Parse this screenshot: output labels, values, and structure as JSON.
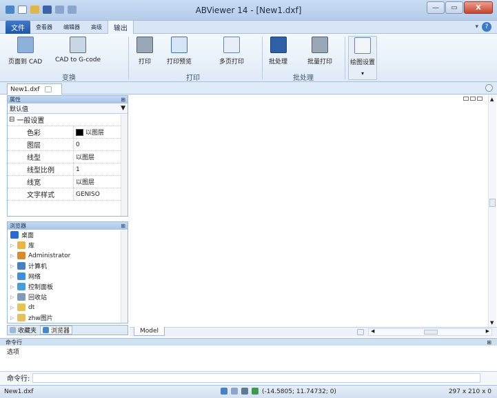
{
  "window": {
    "title": "ABViewer 14 - [New1.dxf]",
    "min": "—",
    "max": "▭",
    "close": "X"
  },
  "ribbon_tabs": [
    "文件",
    "查看器",
    "编辑器",
    "高级",
    "输出"
  ],
  "ribbon_right": {
    "style": "▾",
    "help": "?"
  },
  "ribbon": {
    "buttons": [
      {
        "label": "页面到 CAD",
        "icon": "page-to-cad-icon"
      },
      {
        "label": "CAD to G-code",
        "icon": "gcode-icon"
      },
      {
        "label": "打印",
        "icon": "printer-icon"
      },
      {
        "label": "打印预览",
        "icon": "print-preview-icon"
      },
      {
        "label": "多页打印",
        "icon": "multipage-print-icon"
      },
      {
        "label": "批处理",
        "icon": "batch-icon"
      },
      {
        "label": "批量打印",
        "icon": "batch-print-icon"
      },
      {
        "label": "绘图设置",
        "icon": "plot-settings-icon"
      }
    ],
    "groups": [
      "变换",
      "打印",
      "批处理"
    ],
    "dropdown_arrow": "▾"
  },
  "doc_tab": {
    "label": "New1.dxf"
  },
  "properties": {
    "title": "属性",
    "pin": "⊞",
    "selector": "默认值",
    "section": "一般设置",
    "section_expander": "⊟",
    "rows": [
      {
        "key": "色彩",
        "value": "以图层",
        "swatch": "#000000"
      },
      {
        "key": "图层",
        "value": "0"
      },
      {
        "key": "线型",
        "value": "以图层"
      },
      {
        "key": "线型比例",
        "value": "1"
      },
      {
        "key": "线宽",
        "value": "以图层"
      },
      {
        "key": "文字样式",
        "value": "GENISO"
      }
    ]
  },
  "browser": {
    "title": "浏览器",
    "pin": "⊞",
    "items": [
      {
        "label": "桌面",
        "icon": "desktop-icon",
        "color": "#2a6bd1"
      },
      {
        "label": "库",
        "icon": "library-icon",
        "color": "#e5b54a"
      },
      {
        "label": "Administrator",
        "icon": "user-icon",
        "color": "#d98a2b"
      },
      {
        "label": "计算机",
        "icon": "computer-icon",
        "color": "#4a7fc1"
      },
      {
        "label": "网络",
        "icon": "network-icon",
        "color": "#3f8fd8"
      },
      {
        "label": "控制面板",
        "icon": "control-panel-icon",
        "color": "#4c9ad6"
      },
      {
        "label": "回收站",
        "icon": "recycle-bin-icon",
        "color": "#7f9bb8"
      },
      {
        "label": "dt",
        "icon": "folder-icon",
        "color": "#e5c25a"
      },
      {
        "label": "zhw图片",
        "icon": "folder-icon",
        "color": "#e5c25a"
      }
    ],
    "tabs": [
      "收藏夹",
      "浏览器"
    ]
  },
  "drawing": {
    "model_tab": "Model"
  },
  "command": {
    "title": "命令行",
    "output": "选项",
    "prompt": "命令行:"
  },
  "status": {
    "file": "New1.dxf",
    "coords": "(-14.5805; 11.74732; 0)",
    "paper": "297 x 210 x 0"
  }
}
